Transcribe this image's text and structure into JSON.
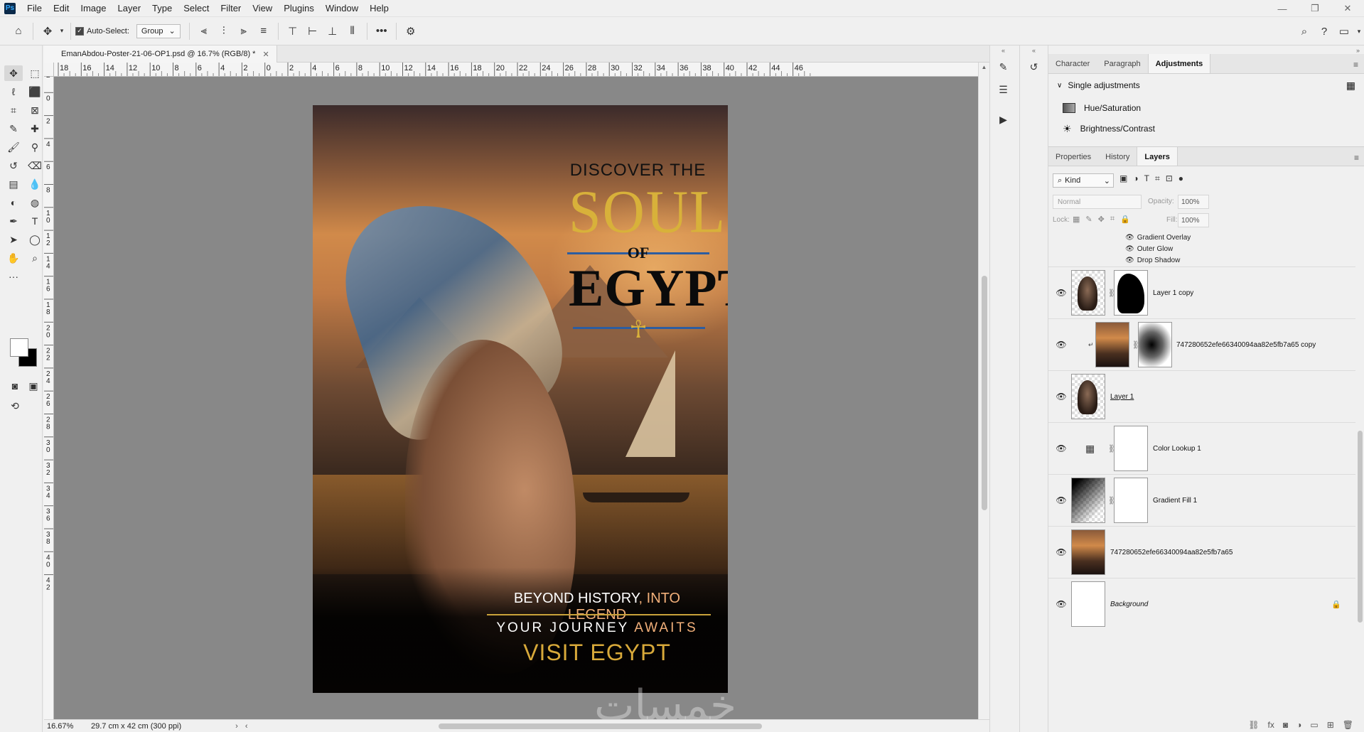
{
  "app": {
    "logo": "Ps",
    "menu": [
      "File",
      "Edit",
      "Image",
      "Layer",
      "Type",
      "Select",
      "Filter",
      "View",
      "Plugins",
      "Window",
      "Help"
    ]
  },
  "options_bar": {
    "auto_select_label": "Auto-Select:",
    "auto_select_value": "Group",
    "more_label": "•••"
  },
  "document": {
    "tab_title": "EmanAbdou-Poster-21-06-OP1.psd @ 16.7% (RGB/8) *",
    "zoom": "16.67%",
    "doc_size": "29.7 cm x 42 cm (300 ppi)",
    "ruler_top": [
      "18",
      "16",
      "14",
      "12",
      "10",
      "8",
      "6",
      "4",
      "2",
      "0",
      "2",
      "4",
      "6",
      "8",
      "10",
      "12",
      "14",
      "16",
      "18",
      "20",
      "22",
      "24",
      "26",
      "28",
      "30",
      "32",
      "34",
      "36",
      "38",
      "40",
      "42",
      "44",
      "46"
    ],
    "ruler_left": [
      "2",
      "0",
      "2",
      "4",
      "6",
      "8",
      "1\n0",
      "1\n2",
      "1\n4",
      "1\n6",
      "1\n8",
      "2\n0",
      "2\n2",
      "2\n4",
      "2\n6",
      "2\n8",
      "3\n0",
      "3\n2",
      "3\n4",
      "3\n6",
      "3\n8",
      "4\n0",
      "4\n2"
    ]
  },
  "poster": {
    "discover": "DISCOVER THE",
    "soul": "SOUL",
    "of": "OF",
    "egypt": "EGYPT",
    "ankh": "☥",
    "beyond_a": "BEYOND HISTORY",
    "beyond_b": ", INTO LEGEND",
    "journey_a": "YOUR JOURNEY ",
    "journey_b": "AWAITS",
    "visit": "VISIT EGYPT"
  },
  "watermark": "خمسات",
  "adjustments_panel": {
    "tabs": [
      "Character",
      "Paragraph",
      "Adjustments"
    ],
    "active_tab": "Adjustments",
    "section": "Single adjustments",
    "items": [
      "Hue/Saturation",
      "Brightness/Contrast"
    ]
  },
  "layers_panel": {
    "tabs": [
      "Properties",
      "History",
      "Layers"
    ],
    "active_tab": "Layers",
    "kind": "Kind",
    "blend_mode": "Normal",
    "opacity_label": "Opacity:",
    "opacity": "100%",
    "lock_label": "Lock:",
    "fill_label": "Fill:",
    "fill": "100%",
    "effects": [
      "Gradient Overlay",
      "Outer Glow",
      "Drop Shadow"
    ],
    "layers": [
      {
        "name": "Layer 1 copy"
      },
      {
        "name": "747280652efe66340094aa82e5fb7a65  copy"
      },
      {
        "name": "Layer 1"
      },
      {
        "name": "Color Lookup 1"
      },
      {
        "name": "Gradient Fill 1"
      },
      {
        "name": "747280652efe66340094aa82e5fb7a65"
      },
      {
        "name": "Background"
      }
    ]
  },
  "colors": {
    "accent_blue": "#2d5da0",
    "gold": "#d8b13a",
    "canvas_bg": "#888888"
  }
}
